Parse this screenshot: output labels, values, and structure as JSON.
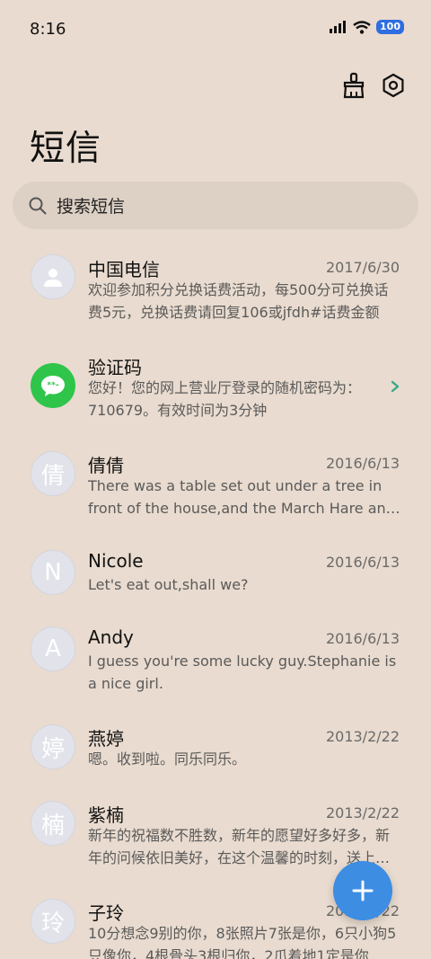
{
  "status_bar": {
    "time": "8:16",
    "battery": "100"
  },
  "header": {
    "title": "短信"
  },
  "search": {
    "placeholder": "搜索短信"
  },
  "messages": [
    {
      "name": "中国电信",
      "date": "2017/6/30",
      "preview": "欢迎参加积分兑换话费活动，每500分可兑换话费5元，兑换话费请回复106或jfdh#话费金额",
      "avatar_char": "",
      "avatar_icon": "person-icon"
    },
    {
      "name": "验证码",
      "date": "",
      "preview": "您好！您的网上营业厅登录的随机密码为：710679。有效时间为3分钟",
      "avatar_char": "",
      "avatar_icon": "verification-code-icon"
    },
    {
      "name": "倩倩",
      "date": "2016/6/13",
      "preview": "There was a table set out under a tree in front of the house,and the March Hare and the Hatter were having tea at it",
      "avatar_char": "倩"
    },
    {
      "name": "Nicole",
      "date": "2016/6/13",
      "preview": "Let's eat out,shall we?",
      "avatar_char": "N"
    },
    {
      "name": "Andy",
      "date": "2016/6/13",
      "preview": "I guess you're some lucky guy.Stephanie is a nice girl.",
      "avatar_char": "A"
    },
    {
      "name": "燕婷",
      "date": "2013/2/22",
      "preview": "嗯。收到啦。同乐同乐。",
      "avatar_char": "婷"
    },
    {
      "name": "紫楠",
      "date": "2013/2/22",
      "preview": "新年的祝福数不胜数，新年的愿望好多好多，新年的问候依旧美好，在这个温馨的时刻，送上我的祝福",
      "avatar_char": "楠"
    },
    {
      "name": "子玲",
      "date": "2013/2/22",
      "preview": "10分想念9别的你，8张照片7张是你，6只小狗5只像你，4根骨头3根归你，2爪着地1定是你",
      "avatar_char": "玲"
    }
  ],
  "colors": {
    "background": "#e9dbcf",
    "accent": "#3d8de3",
    "green_avatar": "#2fc54a"
  }
}
